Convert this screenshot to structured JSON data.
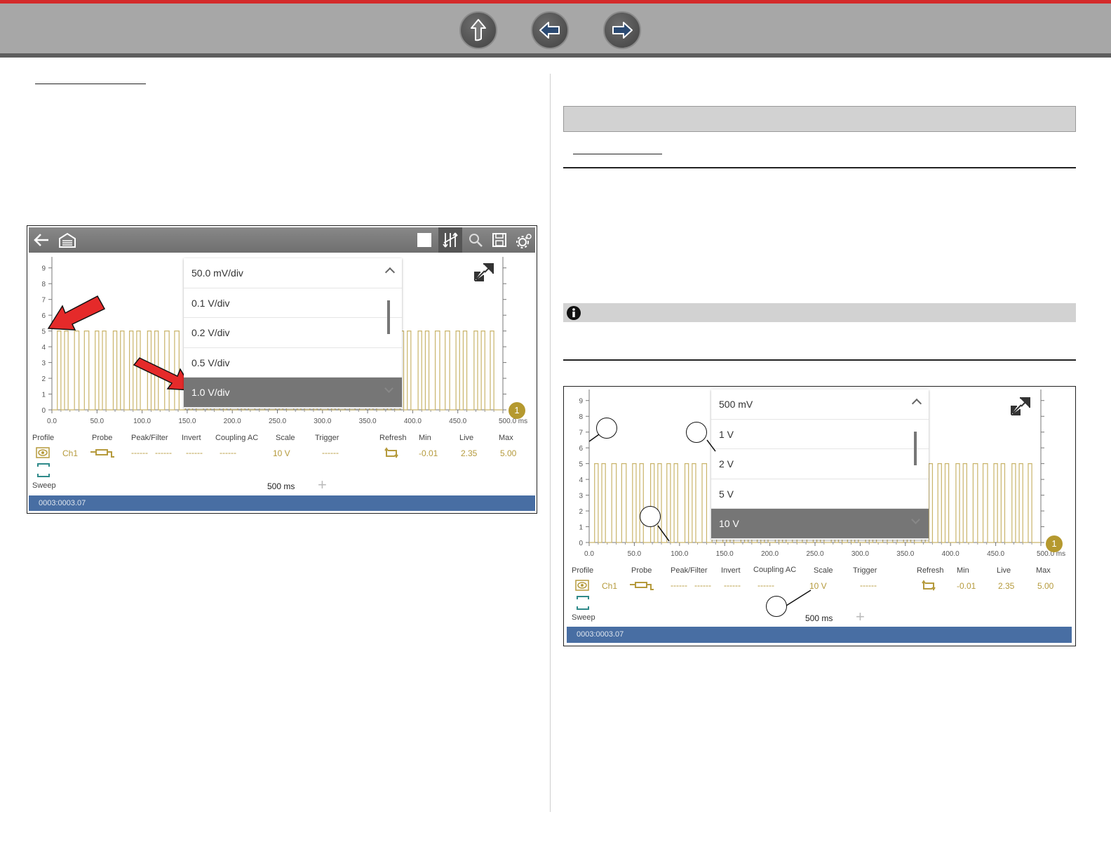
{
  "nav": {
    "icons": [
      "up-arrow-icon",
      "back-arrow-icon",
      "forward-arrow-icon"
    ]
  },
  "colors": {
    "accent_red": "#d42a2a",
    "status_blue": "#486ea3",
    "signal_gold": "#c9b46a"
  },
  "left_shot": {
    "y_ticks": [
      "0",
      "1",
      "2",
      "3",
      "4",
      "5",
      "6",
      "7",
      "8",
      "9"
    ],
    "x_ticks": [
      "0.0",
      "50.0",
      "100.0",
      "150.0",
      "200.0",
      "250.0",
      "300.0",
      "350.0",
      "400.0",
      "450.0",
      "500.0 ms"
    ],
    "dropdown": {
      "header": "50.0 mV/div",
      "items": [
        "0.1 V/div",
        "0.2 V/div",
        "0.5 V/div",
        "1.0 V/div"
      ],
      "selected_index": 3
    },
    "controls": {
      "profile": "Profile",
      "probe": "Probe",
      "peak_filter": "Peak/Filter",
      "invert": "Invert",
      "coupling": "Coupling AC",
      "scale": "Scale",
      "trigger": "Trigger",
      "refresh": "Refresh",
      "min": "Min",
      "live": "Live",
      "max": "Max"
    },
    "values": {
      "channel": "Ch1",
      "dash": "------",
      "scale": "10 V",
      "min": "-0.01",
      "live": "2.35",
      "max": "5.00"
    },
    "sweep_label": "Sweep",
    "sweep_value": "500 ms",
    "plus": "+",
    "status": "0003:0003.07",
    "badge": "1"
  },
  "right_shot": {
    "y_ticks": [
      "0",
      "1",
      "2",
      "3",
      "4",
      "5",
      "6",
      "7",
      "8",
      "9"
    ],
    "x_ticks": [
      "0.0",
      "50.0",
      "100.0",
      "150.0",
      "200.0",
      "250.0",
      "300.0",
      "350.0",
      "400.0",
      "450.0",
      "500.0 ms"
    ],
    "dropdown": {
      "header": "500 mV",
      "items": [
        "1 V",
        "2 V",
        "5 V",
        "10 V"
      ],
      "selected_index": 3
    },
    "controls": {
      "profile": "Profile",
      "probe": "Probe",
      "peak_filter": "Peak/Filter",
      "invert": "Invert",
      "coupling": "Coupling AC",
      "scale": "Scale",
      "trigger": "Trigger",
      "refresh": "Refresh",
      "min": "Min",
      "live": "Live",
      "max": "Max"
    },
    "values": {
      "channel": "Ch1",
      "dash": "------",
      "scale": "10 V",
      "min": "-0.01",
      "live": "2.35",
      "max": "5.00"
    },
    "sweep_label": "Sweep",
    "sweep_value": "500 ms",
    "plus": "+",
    "status": "0003:0003.07",
    "badge": "1"
  }
}
